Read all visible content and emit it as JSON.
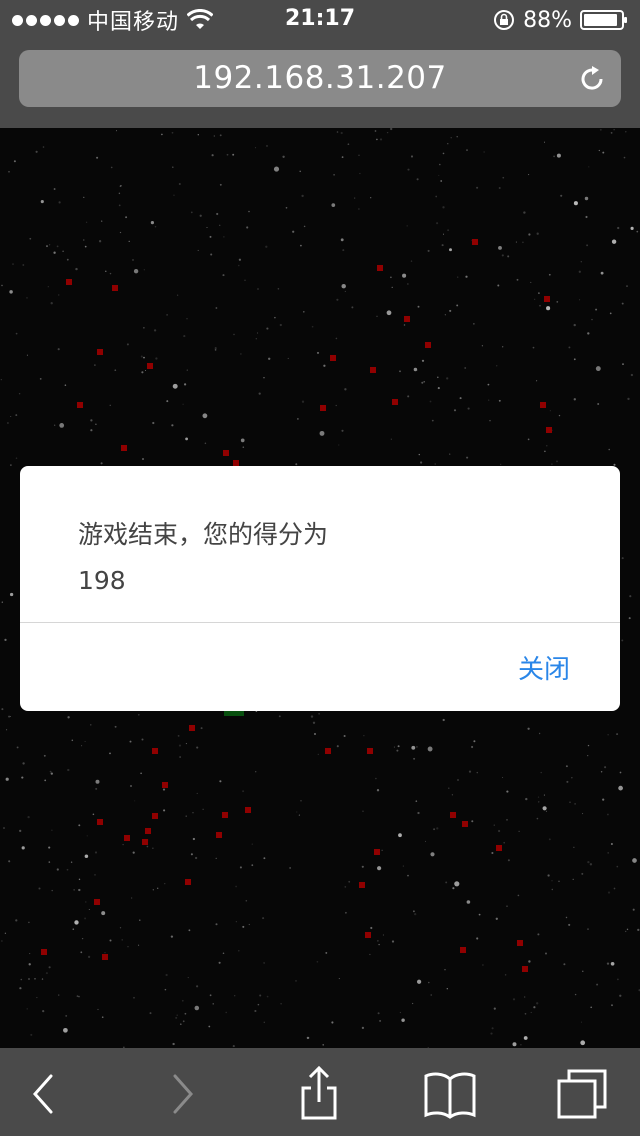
{
  "status_bar": {
    "carrier": "中国移动",
    "time": "21:17",
    "battery": "88%"
  },
  "address_bar": {
    "url": "192.168.31.207"
  },
  "dialog": {
    "message_line1": "游戏结束，您的得分为",
    "message_line2": "198",
    "close_label": "关闭"
  },
  "icons": {
    "wifi": "wifi-icon",
    "rotation_lock": "lock-icon",
    "battery": "battery-icon",
    "reload": "reload-icon",
    "back": "back-icon",
    "forward": "forward-icon",
    "share": "share-icon",
    "bookmarks": "book-icon",
    "tabs": "tabs-icon"
  },
  "colors": {
    "enemy": "#c00000",
    "player": "#0b6b14",
    "link": "#2a86e8",
    "bar": "#4a4a4a"
  }
}
